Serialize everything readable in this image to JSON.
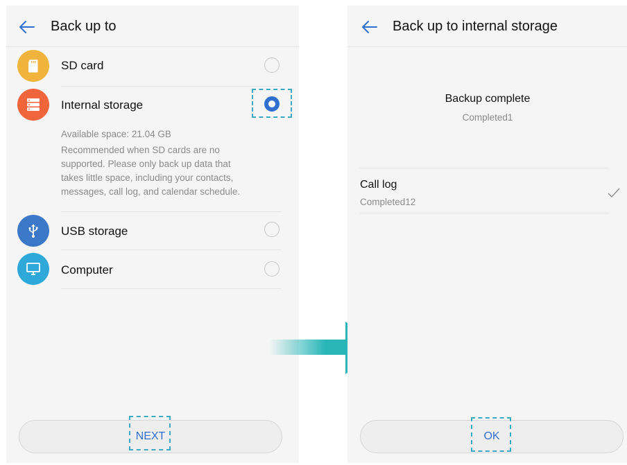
{
  "left_screen": {
    "title": "Back up to",
    "options": [
      {
        "label": "SD card",
        "icon": "sd-card-icon",
        "color": "#f0b43c",
        "selected": false
      },
      {
        "label": "Internal storage",
        "icon": "storage-icon",
        "color": "#f0653c",
        "selected": true
      },
      {
        "label": "USB storage",
        "icon": "usb-icon",
        "color": "#3c78c8",
        "selected": false
      },
      {
        "label": "Computer",
        "icon": "computer-icon",
        "color": "#2ea8d8",
        "selected": false
      }
    ],
    "details": {
      "available": "Available space: 21.04 GB",
      "description": "Recommended when SD cards are no supported. Please only back up data that takes little space, including your contacts, messages, call log, and calendar schedule."
    },
    "next_button": "NEXT"
  },
  "right_screen": {
    "title": "Back up to internal storage",
    "status_title": "Backup complete",
    "status_subtitle": "Completed1",
    "item_label": "Call log",
    "item_status": "Completed12",
    "ok_button": "OK"
  },
  "colors": {
    "accent": "#2f6fcf",
    "highlight": "#39a9c4",
    "arrow": "#2ab6b8"
  }
}
